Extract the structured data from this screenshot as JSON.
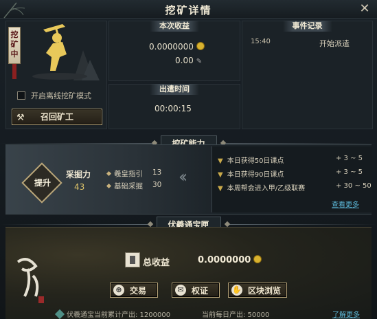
{
  "window": {
    "title": "挖矿详情",
    "close_glyph": "✕"
  },
  "status_tag": "挖矿中",
  "offline_mode": {
    "label": "开启离线挖矿模式",
    "checked": false
  },
  "recall_button": {
    "label": "召回矿工"
  },
  "income": {
    "header": "本次收益",
    "coin_amount": "0.0000000",
    "secondary_amount": "0.00"
  },
  "dispatch": {
    "header": "出遣时间",
    "time": "00:00:15"
  },
  "events": {
    "header": "事件记录",
    "rows": [
      {
        "time": "15:40",
        "text": "开始派遣"
      }
    ]
  },
  "ability": {
    "header": "挖矿能力",
    "upgrade_label": "提升",
    "dig_label": "采掘力",
    "dig_value": "43",
    "attributes": [
      {
        "name": "羲皇指引",
        "value": "13"
      },
      {
        "name": "基础采掘",
        "value": "30"
      }
    ],
    "tasks": [
      {
        "text": "本日获得50日课点",
        "reward": "+ 3 ~ 5"
      },
      {
        "text": "本日获得90日课点",
        "reward": "+ 3 ~ 5"
      },
      {
        "text": "本周帮会进入甲/乙级联赛",
        "reward": "+ 30 ~ 50"
      }
    ],
    "more_link": "查看更多"
  },
  "treasury": {
    "header": "伏羲通宝匣",
    "total_label": "总收益",
    "total_value": "0.0000000",
    "buttons": [
      {
        "label": "交易",
        "icon": "trade-icon"
      },
      {
        "label": "权证",
        "icon": "certificate-icon"
      },
      {
        "label": "区块浏览",
        "icon": "block-browse-icon"
      }
    ],
    "footer_total": "伏羲通宝当前累计产出: 1200000",
    "footer_daily": "当前每日产出: 50000",
    "learn_more": "了解更多"
  },
  "colors": {
    "gold": "#b9a67a",
    "link": "#5bb6d6",
    "coin": "#d8b22f"
  }
}
